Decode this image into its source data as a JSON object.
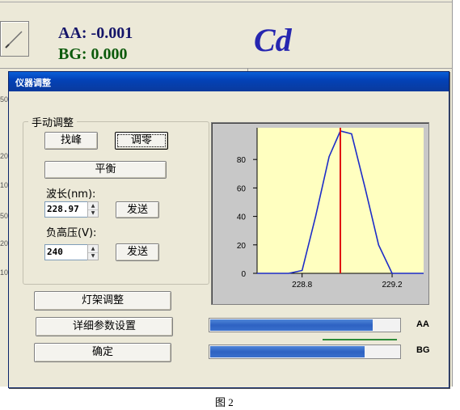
{
  "background_app": {
    "aa_readout": "AA: -0.001",
    "bg_readout": "BG:  0.000",
    "element_symbol": "Cd",
    "edge_numbers": [
      "50",
      "20",
      "10",
      "20",
      "10",
      "50"
    ]
  },
  "dialog": {
    "title": "仪器调整",
    "manual_group": {
      "title": "手动调整",
      "find_peak_label": "找峰",
      "zero_label": "调零",
      "balance_label": "平衡",
      "wavelength_label": "波长(nm):",
      "wavelength_value": "228.97",
      "send_label_1": "发送",
      "hv_label": "负高压(V):",
      "hv_value": "240",
      "send_label_2": "发送"
    },
    "lamp_adjust_label": "灯架调整",
    "detailed_settings_label": "详细参数设置",
    "ok_label": "确定",
    "aa_bar": {
      "label": "AA",
      "level_fraction": 0.85
    },
    "bg_bar": {
      "label": "BG",
      "level_fraction": 0.81
    }
  },
  "chart_data": {
    "type": "line",
    "x": [
      228.6,
      228.74,
      228.8,
      228.86,
      228.92,
      228.97,
      229.02,
      229.08,
      229.14,
      229.2,
      229.34
    ],
    "series": [
      {
        "values": [
          0,
          0,
          2,
          40,
          82,
          100,
          98,
          60,
          20,
          0,
          0
        ]
      }
    ],
    "xticks": [
      "228.8",
      "229.2"
    ],
    "yticks": [
      "0",
      "20",
      "40",
      "60",
      "80"
    ],
    "xlim": [
      228.6,
      229.34
    ],
    "ylim": [
      0,
      100
    ],
    "marker_x": 228.97,
    "colors": {
      "line": "#1c2cc8",
      "marker": "#e01010",
      "plot_bg": "#ffffc0"
    },
    "grid": false
  },
  "caption": "图 2"
}
